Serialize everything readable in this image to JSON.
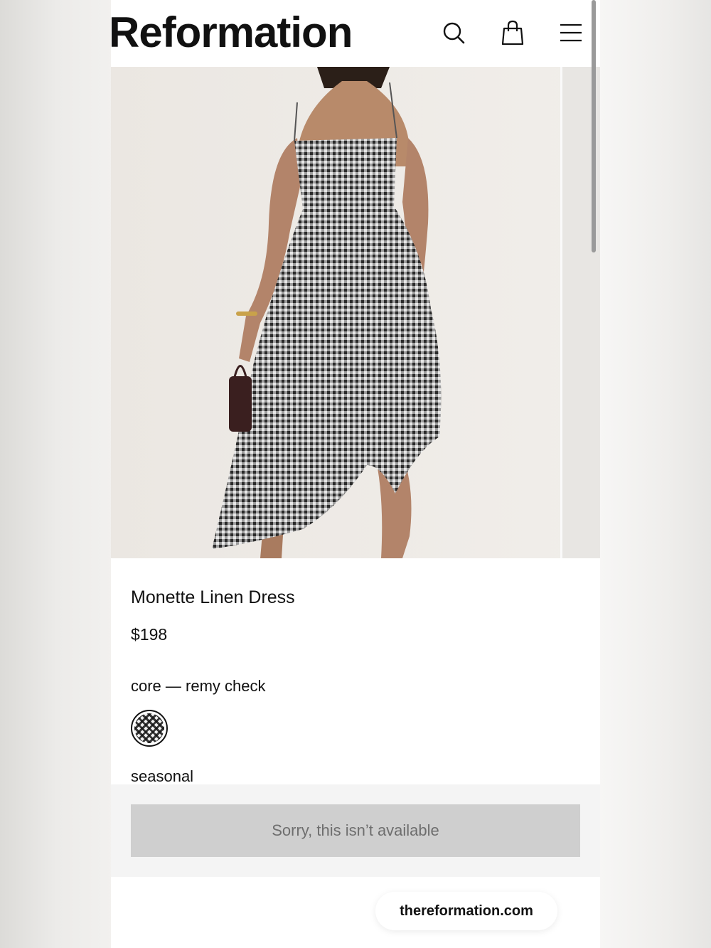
{
  "header": {
    "logo": "Reformation",
    "search_icon": "search-icon",
    "bag_icon": "shopping-bag-icon",
    "menu_icon": "hamburger-menu-icon"
  },
  "hero": {
    "image": "model wearing gingham midi dress"
  },
  "product": {
    "name": "Monette Linen Dress",
    "price": "$198",
    "color_label": "core — remy check",
    "swatch": "remy check",
    "seasonal_label": "seasonal"
  },
  "cta": {
    "label": "Sorry, this isn’t available"
  },
  "browser": {
    "url": "thereformation.com"
  },
  "colors": {
    "text": "#111111",
    "cta_bg": "#cfcfcf",
    "cta_text": "#6e6e6e",
    "page_bg": "#ffffff"
  }
}
